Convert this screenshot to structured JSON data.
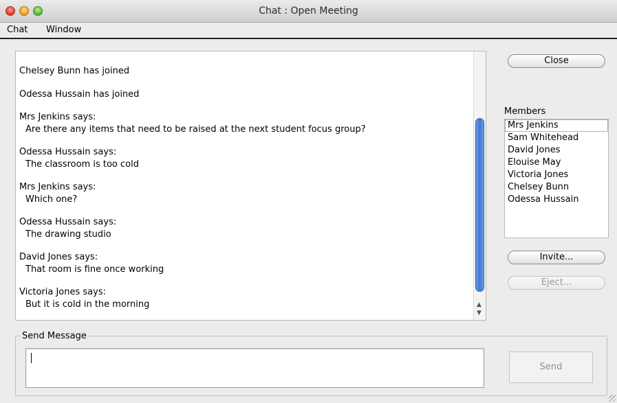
{
  "window": {
    "title": "Chat : Open Meeting",
    "controls": [
      "close",
      "minimize",
      "zoom"
    ]
  },
  "menubar": {
    "items": [
      "Chat",
      "Window"
    ]
  },
  "chat": {
    "messages": [
      {
        "head": "Chelsey Bunn has joined",
        "body": ""
      },
      {
        "head": "Odessa Hussain has joined",
        "body": ""
      },
      {
        "head": "Mrs Jenkins says:",
        "body": "Are there any items that need to be raised at the next student focus group?"
      },
      {
        "head": "Odessa Hussain says:",
        "body": "The classroom is too cold"
      },
      {
        "head": "Mrs Jenkins says:",
        "body": "Which one?"
      },
      {
        "head": "Odessa Hussain says:",
        "body": "The drawing studio"
      },
      {
        "head": "David Jones says:",
        "body": "That room is fine once working"
      },
      {
        "head": "Victoria Jones says:",
        "body": "But it is cold in the morning"
      }
    ]
  },
  "sidebar": {
    "close_label": "Close",
    "members_label": "Members",
    "members": [
      "Mrs Jenkins",
      "Sam Whitehead",
      "David Jones",
      "Elouise May",
      "Victoria Jones",
      "Chelsey Bunn",
      "Odessa Hussain"
    ],
    "invite_label": "Invite...",
    "eject_label": "Eject..."
  },
  "send": {
    "group_label": "Send Message",
    "input_value": "",
    "send_label": "Send"
  }
}
